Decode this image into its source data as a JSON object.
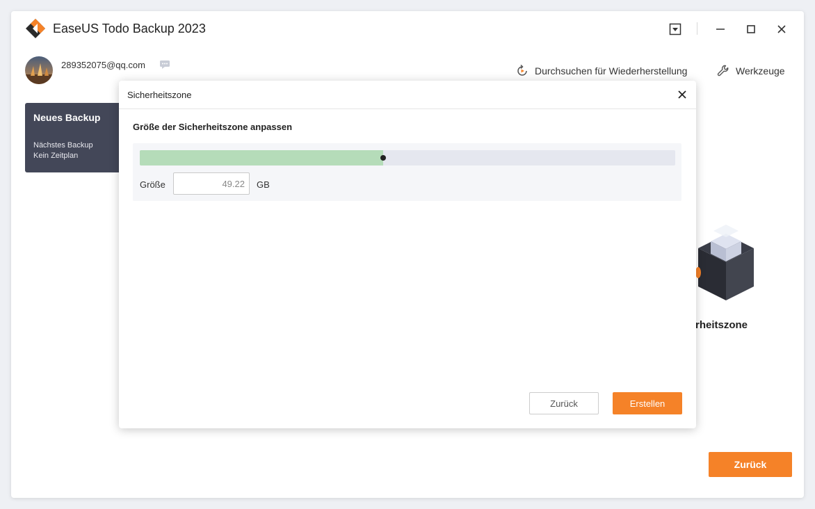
{
  "app": {
    "title": "EaseUS Todo Backup 2023",
    "accent_color": "#f58228"
  },
  "title_bar": {
    "icons": [
      "dropdown-menu-icon",
      "minimize-icon",
      "maximize-icon",
      "close-icon"
    ]
  },
  "account": {
    "email": "289352075@qq.com",
    "message_icon": "message-icon"
  },
  "toolbar": {
    "browse_recovery": {
      "label": "Durchsuchen für Wiederherstellung",
      "icon": "recovery-icon"
    },
    "tools": {
      "label": "Werkzeuge",
      "icon": "wrench-icon"
    }
  },
  "backup_card": {
    "title": "Neues Backup",
    "next_backup": "Nächstes Backup",
    "schedule": "Kein Zeitplan"
  },
  "background": {
    "security_zone_label": "rheitszone",
    "back_button": "Zurück"
  },
  "dialog": {
    "title": "Sicherheitszone",
    "subtitle": "Größe der Sicherheitszone anpassen",
    "size_label": "Größe",
    "size_value": "49.22",
    "size_unit": "GB",
    "slider_fraction": 0.455,
    "back_button": "Zurück",
    "create_button": "Erstellen"
  }
}
